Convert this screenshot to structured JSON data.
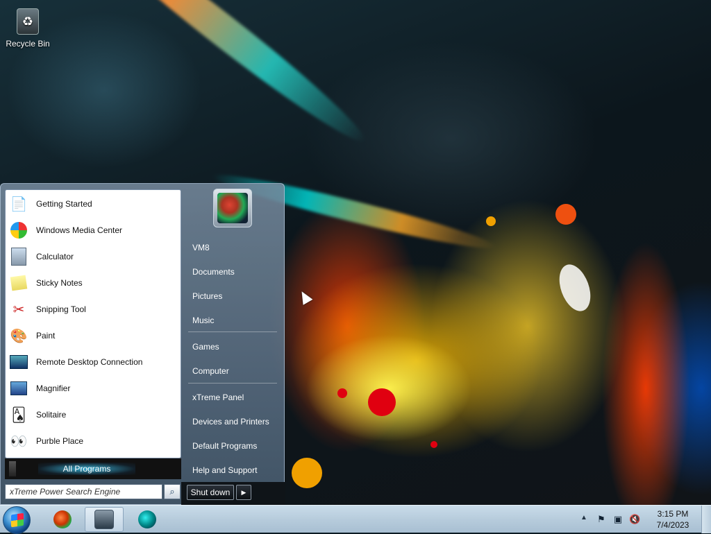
{
  "desktop": {
    "icons": [
      {
        "label": "Recycle Bin",
        "icon": "recycle-bin-icon"
      }
    ]
  },
  "start_menu": {
    "programs": [
      {
        "label": "Getting Started",
        "icon": "getting-started-icon"
      },
      {
        "label": "Windows Media Center",
        "icon": "media-center-icon"
      },
      {
        "label": "Calculator",
        "icon": "calculator-icon"
      },
      {
        "label": "Sticky Notes",
        "icon": "sticky-notes-icon"
      },
      {
        "label": "Snipping Tool",
        "icon": "snipping-tool-icon"
      },
      {
        "label": "Paint",
        "icon": "paint-icon"
      },
      {
        "label": "Remote Desktop Connection",
        "icon": "remote-desktop-icon"
      },
      {
        "label": "Magnifier",
        "icon": "magnifier-icon"
      },
      {
        "label": "Solitaire",
        "icon": "solitaire-icon"
      },
      {
        "label": "Purble Place",
        "icon": "purble-place-icon"
      }
    ],
    "all_programs_label": "All Programs",
    "search_value": "xTreme Power Search Engine",
    "right_items": [
      {
        "label": "VM8"
      },
      {
        "label": "Documents"
      },
      {
        "label": "Pictures"
      },
      {
        "label": "Music"
      },
      {
        "label": "Games"
      },
      {
        "label": "Computer"
      },
      {
        "label": "xTreme Panel"
      },
      {
        "label": "Devices and Printers"
      },
      {
        "label": "Default Programs"
      },
      {
        "label": "Help and Support"
      }
    ],
    "shutdown_label": "Shut down"
  },
  "taskbar": {
    "clock_time": "3:15 PM",
    "clock_date": "7/4/2023",
    "tray_icons": [
      "action-center-flag-icon",
      "network-icon",
      "volume-muted-icon"
    ]
  },
  "colors": {
    "taskbar": "#b7ccdc",
    "start_menu_right": "#5a7088",
    "all_programs_highlight": "#3cbde6"
  }
}
